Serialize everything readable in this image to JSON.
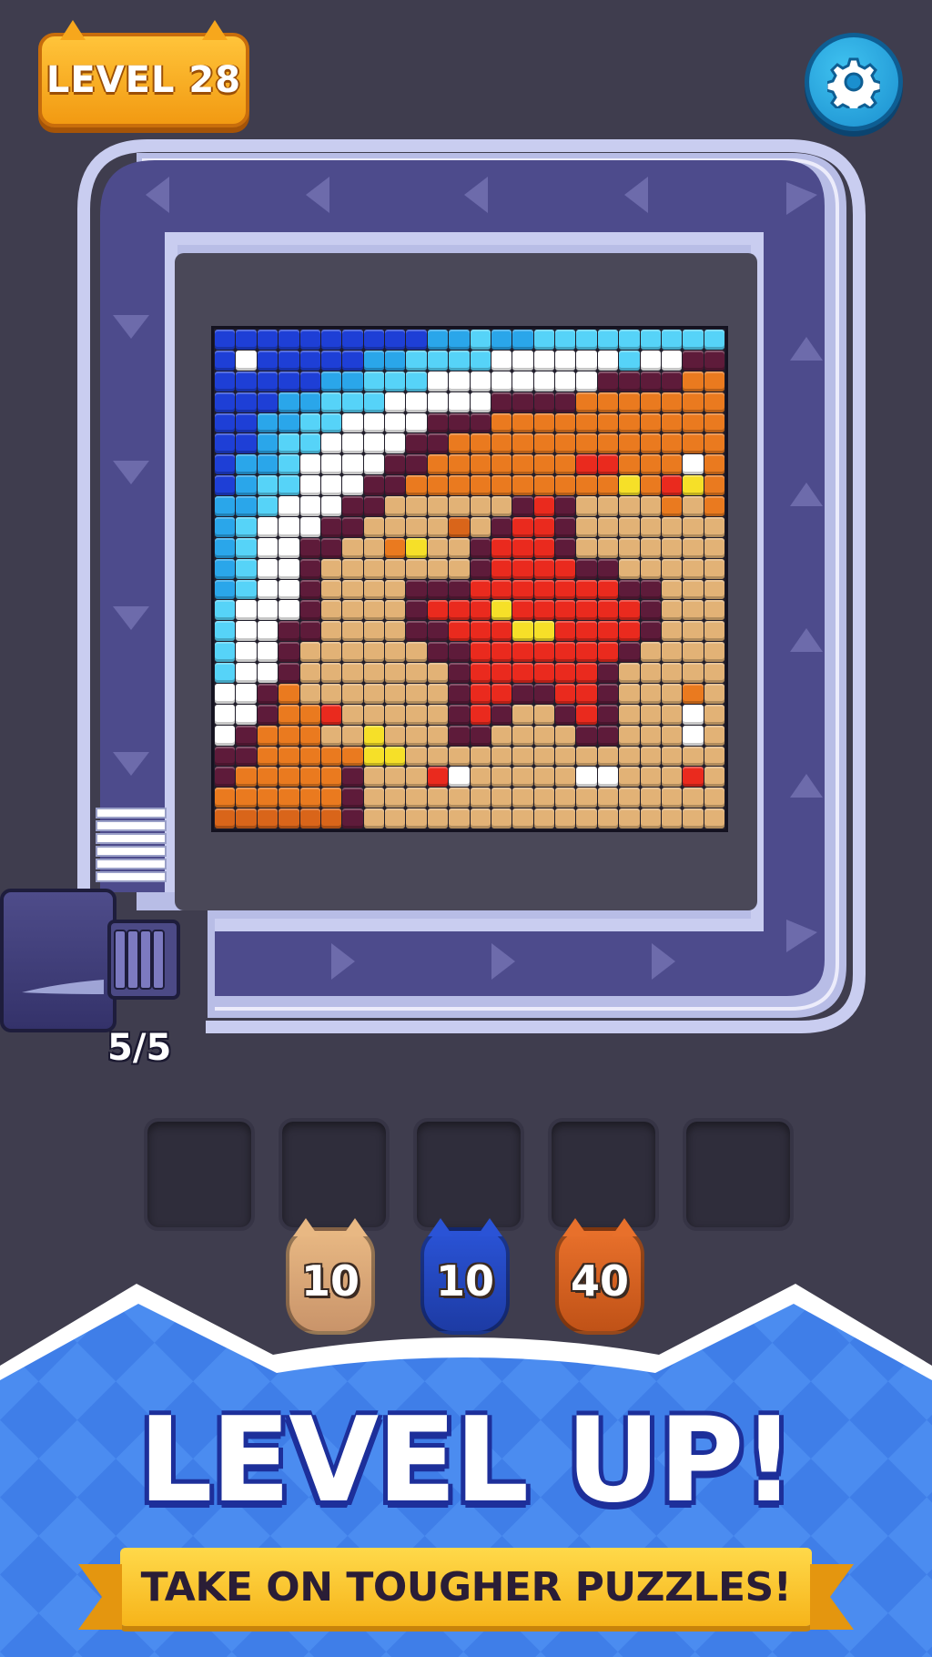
{
  "header": {
    "level_label": "LEVEL 28",
    "settings_icon": "gear-icon"
  },
  "shooter": {
    "ammo": "5/5",
    "icon": "cannon-icon"
  },
  "slots": {
    "count": 5
  },
  "cats": [
    {
      "count": "10",
      "color": "#e8b883",
      "shade": "#c9946a",
      "icon": "cat-icon"
    },
    {
      "count": "10",
      "color": "#2a53d6",
      "shade": "#1d3ba4",
      "icon": "cat-icon"
    },
    {
      "count": "40",
      "color": "#e8702b",
      "shade": "#c05217",
      "icon": "cat-icon"
    }
  ],
  "banner": {
    "title": "LEVEL UP!",
    "subtitle": "TAKE ON TOUGHER PUZZLES!"
  },
  "palette": {
    "B": "#1e3fd6",
    "L": "#2aa6ea",
    "C": "#56d3f8",
    "W": "#ffffff",
    "P": "#5e1b3a",
    "O": "#ea7a1f",
    "D": "#d9651a",
    "T": "#e2b276",
    "R": "#ea2a1e",
    "Y": "#f6e028"
  },
  "pixel_art": [
    "BBBBBBBBBBLLCLLCCCCCCCCC",
    "BWBBBBBLLCCCCWWWWWWCWWPP",
    "BBBBBLLCCCWWWWWWWWPPPPOO",
    "BBBLLCCCWWWWWPPPPOOOOOOO",
    "BBLLCCWWWWPPPOOOOOOOOOOO",
    "BBLCCWWWWPPOOOOOOOOOOOOO",
    "BLLCWWWWPPOOOOOOORROOOWO",
    "BLCCWWWPPOOOOOOOOOOYORYO",
    "LLCWWWPPTTTTTTPRPTTTTOTO",
    "LCWWWPPTTTTDTPRRPTTTTTTT",
    "LCWWPPTTOYTTPRRRPTTTTTTT",
    "LCWWPTTTTTTTPRRRRPPTTTTT",
    "LCWWPTTTTPPPRRRRRRRPPTTT",
    "CWWWPTTTTPRRRYRRRRRRPTTT",
    "CWWPPTTTTPPRRRYYRRRRPTTT",
    "CWWPTTTTTTPPRRRRRRRPTTTT",
    "CWWPTTTTTTTPRRRRRRPTTTTT",
    "WWPOTTTTTTTPRRPPRRPTTTOT",
    "WWPOORTTTTTPRPTTPRPTTTWT",
    "WPOOOTTYTTTPPTTTTPPTTTWT",
    "PPOOOOOYYTTTTTTTTTTTTTTT",
    "POOOOOPTTTRWTTTTTWWTTTRT",
    "OOOOOOPTTTTTTTTTTTTTTTTT",
    "DDDDDDPTTTTTTTTTTTTTTTTT"
  ]
}
